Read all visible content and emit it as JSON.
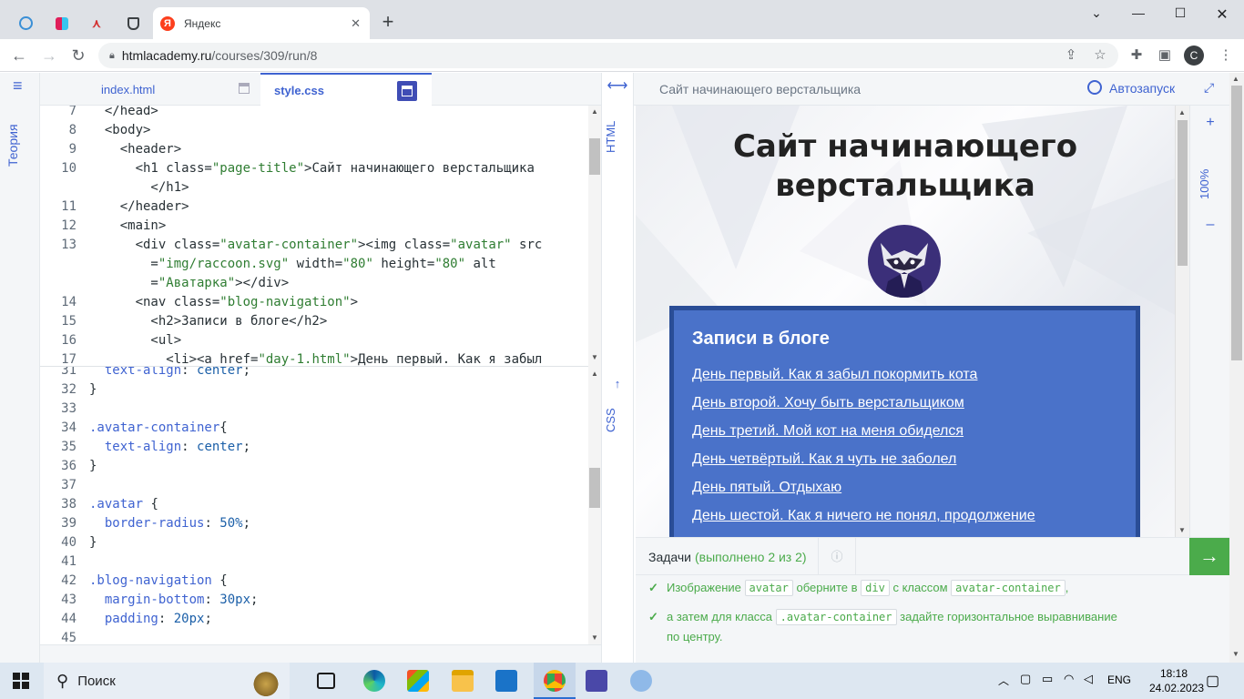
{
  "browser": {
    "tabs": [
      {
        "icon": "edge-icon"
      },
      {
        "icon": "slack-icon"
      },
      {
        "icon": "app-icon"
      },
      {
        "icon": "htmlacademy-icon"
      },
      {
        "title": "Яндекс",
        "icon": "yandex-icon",
        "active": true
      }
    ],
    "url_host": "htmlacademy.ru",
    "url_path": "/courses/309/run/8",
    "profile_initial": "С"
  },
  "app": {
    "theory_label": "Теория",
    "editor_tabs": [
      {
        "label": "index.html"
      },
      {
        "label": "style.css",
        "active": true
      }
    ],
    "html_side_label": "HTML",
    "css_side_label": "CSS",
    "preview_title": "Сайт начинающего верстальщика",
    "autorun_label": "Автозапуск",
    "zoom_label": "100%",
    "zoom_in": "+",
    "zoom_out": "–"
  },
  "html_code": [
    {
      "n": "7",
      "text": "  </head>"
    },
    {
      "n": "8",
      "text": "  <body>"
    },
    {
      "n": "9",
      "text": "    <header>"
    },
    {
      "n": "10",
      "text": "      <h1 class=\"page-title\">Сайт начинающего верстальщика"
    },
    {
      "n": "",
      "text": "        </h1>"
    },
    {
      "n": "11",
      "text": "    </header>"
    },
    {
      "n": "12",
      "text": "    <main>"
    },
    {
      "n": "13",
      "text": "      <div class=\"avatar-container\"><img class=\"avatar\" src"
    },
    {
      "n": "",
      "text": "        =\"img/raccoon.svg\" width=\"80\" height=\"80\" alt"
    },
    {
      "n": "",
      "text": "        =\"Аватарка\"></div>"
    },
    {
      "n": "14",
      "text": "      <nav class=\"blog-navigation\">"
    },
    {
      "n": "15",
      "text": "        <h2>Записи в блоге</h2>"
    },
    {
      "n": "16",
      "text": "        <ul>"
    },
    {
      "n": "17",
      "text": "          <li><a href=\"day-1.html\">День первый. Как я забыл"
    }
  ],
  "css_code": [
    {
      "n": "31",
      "text": "  text-align: center;"
    },
    {
      "n": "32",
      "text": "}"
    },
    {
      "n": "33",
      "text": ""
    },
    {
      "n": "34",
      "text": ".avatar-container{"
    },
    {
      "n": "35",
      "text": "  text-align: center;"
    },
    {
      "n": "36",
      "text": "}"
    },
    {
      "n": "37",
      "text": ""
    },
    {
      "n": "38",
      "text": ".avatar {"
    },
    {
      "n": "39",
      "text": "  border-radius: 50%;"
    },
    {
      "n": "40",
      "text": "}"
    },
    {
      "n": "41",
      "text": ""
    },
    {
      "n": "42",
      "text": ".blog-navigation {"
    },
    {
      "n": "43",
      "text": "  margin-bottom: 30px;"
    },
    {
      "n": "44",
      "text": "  padding: 20px;"
    },
    {
      "n": "45",
      "text": ""
    }
  ],
  "preview": {
    "page_title_line1": "Сайт начинающего",
    "page_title_line2": "верстальщика",
    "nav_heading": "Записи в блоге",
    "links": [
      "День первый. Как я забыл покормить кота",
      "День второй. Хочу быть верстальщиком",
      "День третий. Мой кот на меня обиделся",
      "День четвёртый. Как я чуть не заболел",
      "День пятый. Отдыхаю",
      "День шестой. Как я ничего не понял, продолжение"
    ]
  },
  "tasks": {
    "label": "Задачи",
    "done": "(выполнено 2 из 2)",
    "info_icon": "ⓘ",
    "task1": {
      "p1": "Изображение",
      "c1": "avatar",
      "p2": "оберните в",
      "c2": "div",
      "p3": "с классом",
      "c3": "avatar-container",
      "p4": ","
    },
    "task2": {
      "p1": "а затем для класса",
      "c1": ".avatar-container",
      "p2": "задайте горизонтальное выравнивание",
      "p3": "по центру."
    }
  },
  "taskbar": {
    "search_label": "Поиск",
    "lang": "ENG",
    "time": "18:18",
    "date": "24.02.2023"
  },
  "colors": {
    "accent": "#3f63d1",
    "success": "#4bab4b",
    "nav_bg": "#4a72c9"
  }
}
